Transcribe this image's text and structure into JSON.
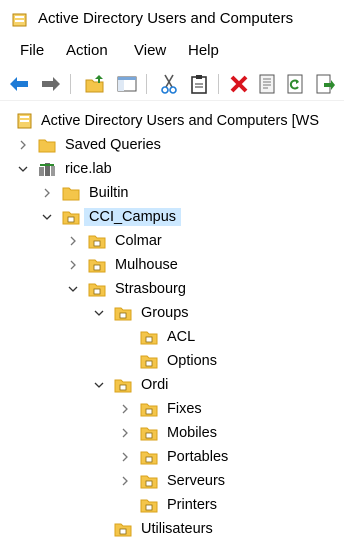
{
  "window": {
    "title": "Active Directory Users and Computers"
  },
  "menu": [
    "File",
    "Action",
    "View",
    "Help"
  ],
  "toolbar": {
    "buttons": [
      "back-arrow-icon",
      "forward-arrow-icon",
      "up-folder-icon",
      "show-console-tree-icon",
      "cut-icon",
      "paste-icon",
      "delete-icon",
      "properties-icon",
      "refresh-icon",
      "export-list-icon"
    ]
  },
  "tree": {
    "root": "Active Directory Users and Computers [WS",
    "saved_queries": "Saved Queries",
    "domain": "rice.lab",
    "builtin": "Builtin",
    "cci_campus": "CCI_Campus",
    "colmar": "Colmar",
    "mulhouse": "Mulhouse",
    "strasbourg": "Strasbourg",
    "groups": "Groups",
    "acl": "ACL",
    "options": "Options",
    "ordi": "Ordi",
    "fixes": "Fixes",
    "mobiles": "Mobiles",
    "portables": "Portables",
    "serveurs": "Serveurs",
    "printers": "Printers",
    "utilisateurs": "Utilisateurs"
  },
  "colors": {
    "selection": "#cce8ff",
    "folder": "#f4c54a",
    "folder_dark": "#d9a21b",
    "accent_blue": "#1e7bd6",
    "delete_red": "#d9141e"
  }
}
